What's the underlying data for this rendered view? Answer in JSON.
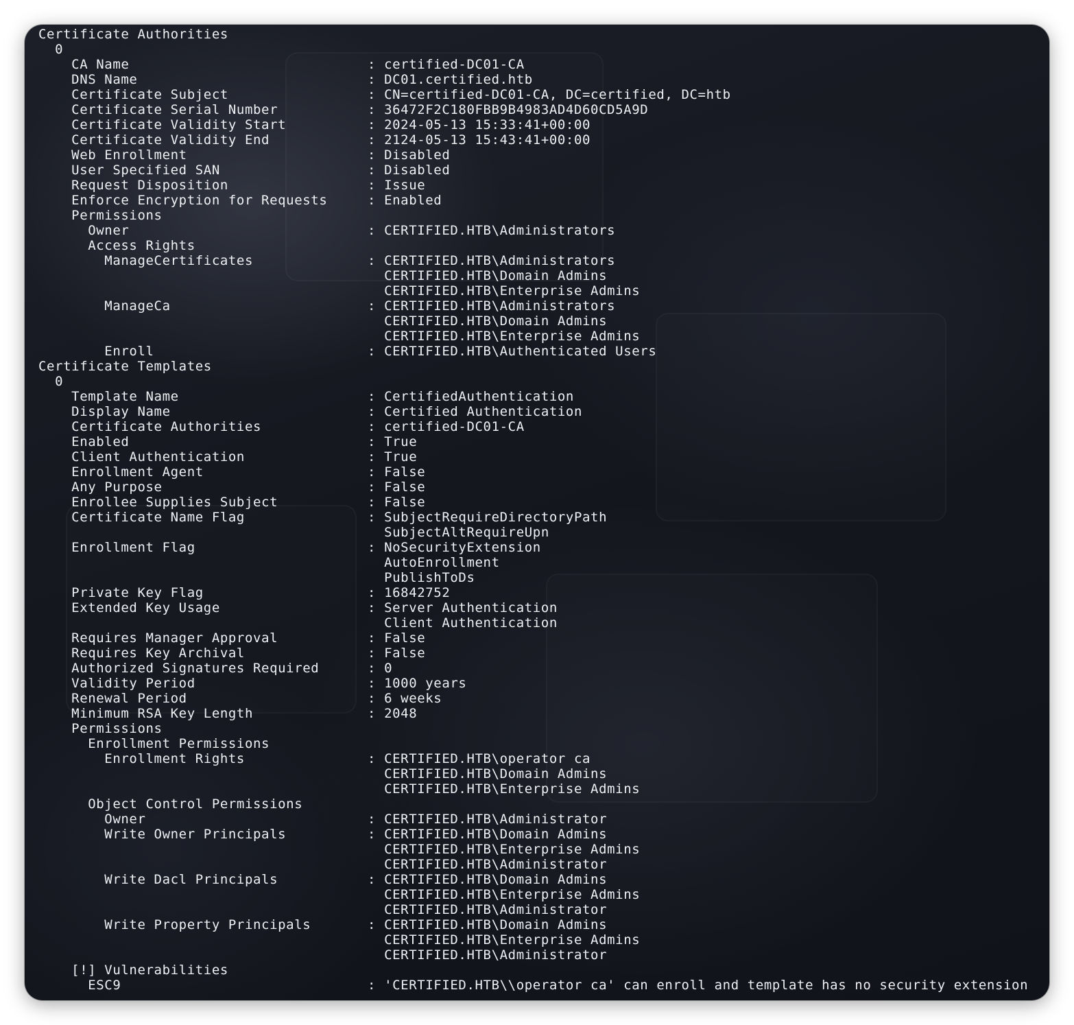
{
  "terminal": {
    "lines": [
      {
        "k": "Certificate Authorities",
        "v": ""
      },
      {
        "k": "  0",
        "v": ""
      },
      {
        "k": "    CA Name",
        "v": ": certified-DC01-CA"
      },
      {
        "k": "    DNS Name",
        "v": ": DC01.certified.htb"
      },
      {
        "k": "    Certificate Subject",
        "v": ": CN=certified-DC01-CA, DC=certified, DC=htb"
      },
      {
        "k": "    Certificate Serial Number",
        "v": ": 36472F2C180FBB9B4983AD4D60CD5A9D"
      },
      {
        "k": "    Certificate Validity Start",
        "v": ": 2024-05-13 15:33:41+00:00"
      },
      {
        "k": "    Certificate Validity End",
        "v": ": 2124-05-13 15:43:41+00:00"
      },
      {
        "k": "    Web Enrollment",
        "v": ": Disabled"
      },
      {
        "k": "    User Specified SAN",
        "v": ": Disabled"
      },
      {
        "k": "    Request Disposition",
        "v": ": Issue"
      },
      {
        "k": "    Enforce Encryption for Requests",
        "v": ": Enabled"
      },
      {
        "k": "    Permissions",
        "v": ""
      },
      {
        "k": "      Owner",
        "v": ": CERTIFIED.HTB\\Administrators"
      },
      {
        "k": "      Access Rights",
        "v": ""
      },
      {
        "k": "        ManageCertificates",
        "v": ": CERTIFIED.HTB\\Administrators"
      },
      {
        "k": "",
        "v": "  CERTIFIED.HTB\\Domain Admins"
      },
      {
        "k": "",
        "v": "  CERTIFIED.HTB\\Enterprise Admins"
      },
      {
        "k": "        ManageCa",
        "v": ": CERTIFIED.HTB\\Administrators"
      },
      {
        "k": "",
        "v": "  CERTIFIED.HTB\\Domain Admins"
      },
      {
        "k": "",
        "v": "  CERTIFIED.HTB\\Enterprise Admins"
      },
      {
        "k": "        Enroll",
        "v": ": CERTIFIED.HTB\\Authenticated Users"
      },
      {
        "k": "Certificate Templates",
        "v": ""
      },
      {
        "k": "  0",
        "v": ""
      },
      {
        "k": "    Template Name",
        "v": ": CertifiedAuthentication"
      },
      {
        "k": "    Display Name",
        "v": ": Certified Authentication"
      },
      {
        "k": "    Certificate Authorities",
        "v": ": certified-DC01-CA"
      },
      {
        "k": "    Enabled",
        "v": ": True"
      },
      {
        "k": "    Client Authentication",
        "v": ": True"
      },
      {
        "k": "    Enrollment Agent",
        "v": ": False"
      },
      {
        "k": "    Any Purpose",
        "v": ": False"
      },
      {
        "k": "    Enrollee Supplies Subject",
        "v": ": False"
      },
      {
        "k": "    Certificate Name Flag",
        "v": ": SubjectRequireDirectoryPath"
      },
      {
        "k": "",
        "v": "  SubjectAltRequireUpn"
      },
      {
        "k": "    Enrollment Flag",
        "v": ": NoSecurityExtension"
      },
      {
        "k": "",
        "v": "  AutoEnrollment"
      },
      {
        "k": "",
        "v": "  PublishToDs"
      },
      {
        "k": "    Private Key Flag",
        "v": ": 16842752"
      },
      {
        "k": "    Extended Key Usage",
        "v": ": Server Authentication"
      },
      {
        "k": "",
        "v": "  Client Authentication"
      },
      {
        "k": "    Requires Manager Approval",
        "v": ": False"
      },
      {
        "k": "    Requires Key Archival",
        "v": ": False"
      },
      {
        "k": "    Authorized Signatures Required",
        "v": ": 0"
      },
      {
        "k": "    Validity Period",
        "v": ": 1000 years"
      },
      {
        "k": "    Renewal Period",
        "v": ": 6 weeks"
      },
      {
        "k": "    Minimum RSA Key Length",
        "v": ": 2048"
      },
      {
        "k": "    Permissions",
        "v": ""
      },
      {
        "k": "      Enrollment Permissions",
        "v": ""
      },
      {
        "k": "        Enrollment Rights",
        "v": ": CERTIFIED.HTB\\operator ca"
      },
      {
        "k": "",
        "v": "  CERTIFIED.HTB\\Domain Admins"
      },
      {
        "k": "",
        "v": "  CERTIFIED.HTB\\Enterprise Admins"
      },
      {
        "k": "      Object Control Permissions",
        "v": ""
      },
      {
        "k": "        Owner",
        "v": ": CERTIFIED.HTB\\Administrator"
      },
      {
        "k": "        Write Owner Principals",
        "v": ": CERTIFIED.HTB\\Domain Admins"
      },
      {
        "k": "",
        "v": "  CERTIFIED.HTB\\Enterprise Admins"
      },
      {
        "k": "",
        "v": "  CERTIFIED.HTB\\Administrator"
      },
      {
        "k": "        Write Dacl Principals",
        "v": ": CERTIFIED.HTB\\Domain Admins"
      },
      {
        "k": "",
        "v": "  CERTIFIED.HTB\\Enterprise Admins"
      },
      {
        "k": "",
        "v": "  CERTIFIED.HTB\\Administrator"
      },
      {
        "k": "        Write Property Principals",
        "v": ": CERTIFIED.HTB\\Domain Admins"
      },
      {
        "k": "",
        "v": "  CERTIFIED.HTB\\Enterprise Admins"
      },
      {
        "k": "",
        "v": "  CERTIFIED.HTB\\Administrator"
      },
      {
        "k": "    [!] Vulnerabilities",
        "v": ""
      },
      {
        "k": "      ESC9",
        "v": ": 'CERTIFIED.HTB\\\\operator ca' can enroll and template has no security extension"
      }
    ]
  }
}
